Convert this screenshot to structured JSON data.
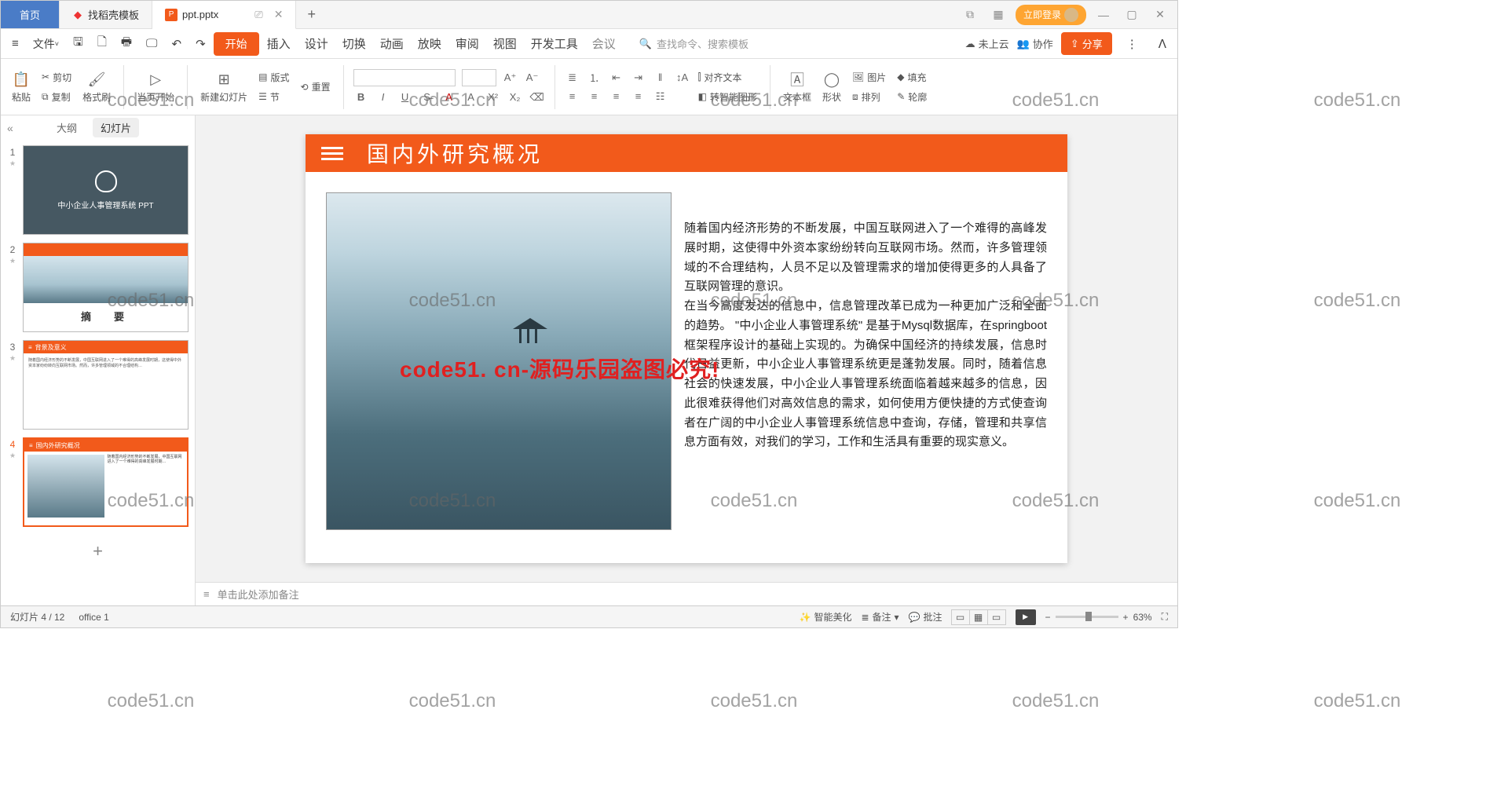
{
  "titlebar": {
    "home": "首页",
    "tab1": "找稻壳模板",
    "tab2": "ppt.pptx",
    "login": "立即登录"
  },
  "menu": {
    "file": "文件",
    "start": "开始",
    "insert": "插入",
    "design": "设计",
    "switch": "切换",
    "anim": "动画",
    "play": "放映",
    "review": "审阅",
    "view": "视图",
    "dev": "开发工具",
    "meeting": "会议",
    "search_placeholder": "查找命令、搜索模板",
    "cloud": "未上云",
    "collab": "协作",
    "share": "分享"
  },
  "ribbon": {
    "paste": "粘贴",
    "cut": "剪切",
    "copy": "复制",
    "format_painter": "格式刷",
    "from_current": "当页开始",
    "new_slide": "新建幻灯片",
    "layout": "版式",
    "section": "节",
    "reset": "重置",
    "align_text": "对齐文本",
    "smart_graphic": "转智能图形",
    "textbox": "文本框",
    "shape": "形状",
    "image": "图片",
    "arrange": "排列",
    "fill": "填充",
    "outline": "轮廓"
  },
  "sidepanel": {
    "outline_tab": "大纲",
    "slides_tab": "幻灯片",
    "thumbs": [
      {
        "num": "1",
        "title": "中小企业人事管理系统  PPT"
      },
      {
        "num": "2",
        "title": "摘　要"
      },
      {
        "num": "3",
        "title": "背景及意义"
      },
      {
        "num": "4",
        "title": "国内外研究概况"
      }
    ]
  },
  "slide": {
    "title": "国内外研究概况",
    "para1": "随着国内经济形势的不断发展，中国互联网进入了一个难得的高峰发展时期，这使得中外资本家纷纷转向互联网市场。然而，许多管理领域的不合理结构，人员不足以及管理需求的增加使得更多的人具备了互联网管理的意识。",
    "para2": "在当今高度发达的信息中，信息管理改革已成为一种更加广泛和全面的趋势。 \"中小企业人事管理系统\" 是基于Mysql数据库，在springboot框架程序设计的基础上实现的。为确保中国经济的持续发展，信息时代日益更新，中小企业人事管理系统更是蓬勃发展。同时，随着信息社会的快速发展，中小企业人事管理系统面临着越来越多的信息，因此很难获得他们对高效信息的需求，如何使用方便快捷的方式使查询者在广阔的中小企业人事管理系统信息中查询，存储，管理和共享信息方面有效，对我们的学习，工作和生活具有重要的现实意义。",
    "watermark": "code51. cn-源码乐园盗图必究!"
  },
  "notes": {
    "placeholder": "单击此处添加备注"
  },
  "status": {
    "slide_pos": "幻灯片 4 / 12",
    "theme": "office 1",
    "beautify": "智能美化",
    "notes": "备注",
    "comments": "批注",
    "zoom": "63%"
  },
  "bg_watermark": "code51.cn"
}
